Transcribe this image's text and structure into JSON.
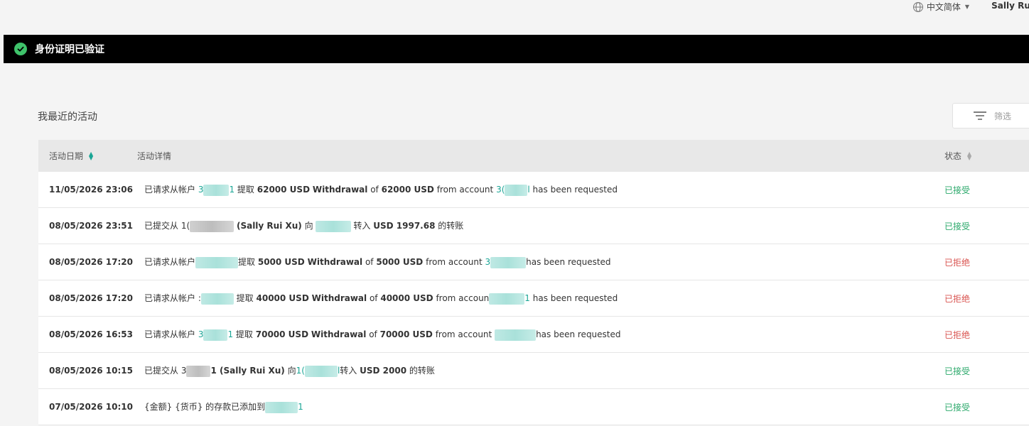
{
  "header": {
    "language": "中文简体",
    "user_name": "Sally Rui"
  },
  "banner": {
    "text": "身份证明已验证"
  },
  "activity": {
    "title": "我最近的活动",
    "filter_label": "筛选",
    "columns": {
      "date": "活动日期",
      "detail": "活动详情",
      "status": "状态"
    },
    "rows": [
      {
        "date": "11/05/2026 23:06",
        "p1": "已请求从帐户 ",
        "a1": "3",
        "a1end": "1",
        "p2": " 提取 ",
        "b1": "62000 USD",
        "p3": " ",
        "b2": "Withdrawal",
        "p4": " of ",
        "b3": "62000 USD",
        "p5": " from account ",
        "a2": "3(",
        "a2end": "l",
        "p6": " has been requested",
        "status": "已接受",
        "status_type": "ok"
      },
      {
        "date": "08/05/2026 23:51",
        "p1": "已提交从 1(",
        "b1": "(Sally Rui Xu)",
        "p2": " 向",
        "p3": " 转入 ",
        "b2": "USD 1997.68",
        "p4": " 的转账",
        "status": "已接受",
        "status_type": "ok"
      },
      {
        "date": "08/05/2026 17:20",
        "p1": "已请求从帐户",
        "p2": "提取 ",
        "b1": "5000 USD",
        "p3": " ",
        "b2": "Withdrawal",
        "p4": " of ",
        "b3": "5000 USD",
        "p5": " from account ",
        "a2": "3",
        "p6": "has been requested",
        "status": "已拒绝",
        "status_type": "rej"
      },
      {
        "date": "08/05/2026 17:20",
        "p1": "已请求从帐户 :",
        "p2": " 提取 ",
        "b1": "40000 USD",
        "p3": " ",
        "b2": "Withdrawal",
        "p4": " of ",
        "b3": "40000 USD",
        "p5": " from accoun",
        "a2end": "1",
        "p6": " has been requested",
        "status": "已拒绝",
        "status_type": "rej"
      },
      {
        "date": "08/05/2026 16:53",
        "p1": "已请求从帐户 ",
        "a1": "3",
        "a1end": "1",
        "p2": " 提取 ",
        "b1": "70000 USD",
        "p3": " ",
        "b2": "Withdrawal",
        "p4": " of ",
        "b3": "70000 USD",
        "p5": " from account ",
        "p6": "has been requested",
        "status": "已拒绝",
        "status_type": "rej"
      },
      {
        "date": "08/05/2026 10:15",
        "p1": "已提交从 3",
        "p1b": "1 ",
        "b1": "(Sally Rui Xu)",
        "p2": " 向",
        "a2": "1(",
        "a2end": "l",
        "p3": "转入 ",
        "b2": "USD 2000",
        "p4": " 的转账",
        "status": "已接受",
        "status_type": "ok"
      },
      {
        "date": "07/05/2026 10:10",
        "p1": "{金额} {货币} 的存款已添加到",
        "a2end": "1",
        "status": "已接受",
        "status_type": "ok"
      }
    ]
  },
  "colors": {
    "accepted": "#2aa86a",
    "rejected": "#d9534f",
    "account_link": "#1aa595",
    "banner_bg": "#000000",
    "check": "#3fc36b"
  }
}
